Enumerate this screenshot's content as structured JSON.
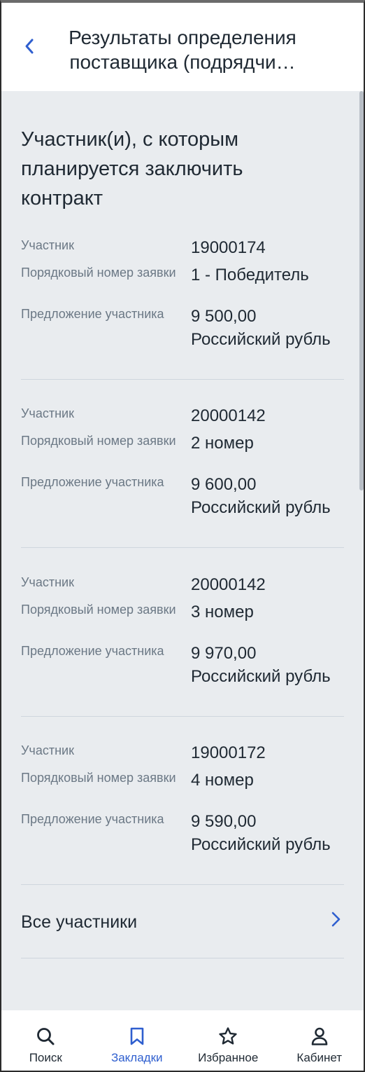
{
  "header": {
    "title": "Результаты определения поставщика (подрядчи…"
  },
  "section": {
    "title": "Участник(и), с которым планируется заключить контракт"
  },
  "labels": {
    "participant": "Участник",
    "order_number": "Порядковый номер заявки",
    "offer": "Предложение участника"
  },
  "entries": [
    {
      "participant": "19000174",
      "order_number": "1 - Победитель",
      "offer_amount": "9 500,00",
      "offer_currency": "Российский рубль"
    },
    {
      "participant": "20000142",
      "order_number": "2 номер",
      "offer_amount": "9 600,00",
      "offer_currency": "Российский рубль"
    },
    {
      "participant": "20000142",
      "order_number": "3 номер",
      "offer_amount": "9 970,00",
      "offer_currency": "Российский рубль"
    },
    {
      "participant": "19000172",
      "order_number": "4 номер",
      "offer_amount": "9 590,00",
      "offer_currency": "Российский рубль"
    }
  ],
  "all_participants": {
    "label": "Все участники",
    "icon": "chevron-right-icon"
  },
  "tabs": [
    {
      "label": "Поиск",
      "icon": "search-icon",
      "active": false
    },
    {
      "label": "Закладки",
      "icon": "bookmark-icon",
      "active": true
    },
    {
      "label": "Избранное",
      "icon": "star-icon",
      "active": false
    },
    {
      "label": "Кабинет",
      "icon": "user-icon",
      "active": false
    }
  ],
  "colors": {
    "accent": "#2f5fcf",
    "background": "#e9ecef",
    "text": "#1f2933",
    "label": "#6b7885"
  }
}
